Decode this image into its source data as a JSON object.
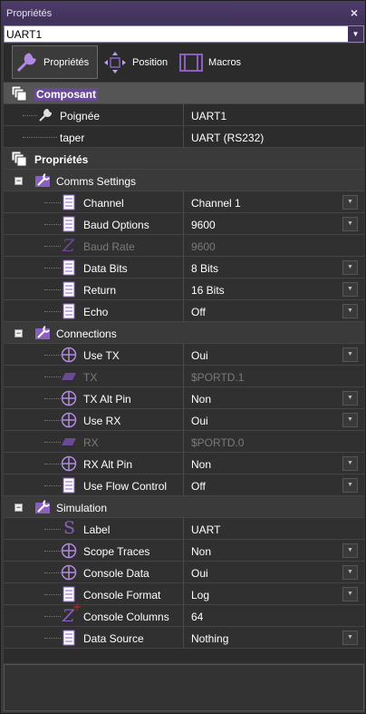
{
  "window": {
    "title": "Propriétés",
    "close_glyph": "×"
  },
  "selector": {
    "value": "UART1",
    "dropdown_glyph": "▼"
  },
  "toolbar": {
    "tabs": [
      {
        "label": "Propriétés",
        "icon": "wrench-icon"
      },
      {
        "label": "Position",
        "icon": "move-arrows-icon"
      },
      {
        "label": "Macros",
        "icon": "macro-icon"
      }
    ]
  },
  "sections": {
    "composant": {
      "label": "Composant",
      "rows": [
        {
          "name": "Poignée",
          "value": "UART1",
          "icon": "wrench-icon"
        },
        {
          "name": "taper",
          "value": "UART (RS232)",
          "icon": ""
        }
      ]
    },
    "proprietes": {
      "label": "Propriétés"
    }
  },
  "groups": {
    "comms": {
      "label": "Comms Settings",
      "rows": [
        {
          "name": "Channel",
          "value": "Channel 1",
          "icon": "list-icon",
          "enabled": true,
          "dropdown": true
        },
        {
          "name": "Baud Options",
          "value": "9600",
          "icon": "list-icon",
          "enabled": true,
          "dropdown": true
        },
        {
          "name": "Baud Rate",
          "value": "9600",
          "icon": "integer-icon",
          "enabled": false,
          "dropdown": false
        },
        {
          "name": "Data Bits",
          "value": "8 Bits",
          "icon": "list-icon",
          "enabled": true,
          "dropdown": true
        },
        {
          "name": "Return",
          "value": "16 Bits",
          "icon": "list-icon",
          "enabled": true,
          "dropdown": true
        },
        {
          "name": "Echo",
          "value": "Off",
          "icon": "list-icon",
          "enabled": true,
          "dropdown": true
        }
      ]
    },
    "connections": {
      "label": "Connections",
      "rows": [
        {
          "name": "Use TX",
          "value": "Oui",
          "icon": "boolean-icon",
          "enabled": true,
          "dropdown": true
        },
        {
          "name": "TX",
          "value": "$PORTD.1",
          "icon": "pin-icon",
          "enabled": false,
          "dropdown": false
        },
        {
          "name": "TX Alt Pin",
          "value": "Non",
          "icon": "boolean-icon",
          "enabled": true,
          "dropdown": true
        },
        {
          "name": "Use RX",
          "value": "Oui",
          "icon": "boolean-icon",
          "enabled": true,
          "dropdown": true
        },
        {
          "name": "RX",
          "value": "$PORTD.0",
          "icon": "pin-icon",
          "enabled": false,
          "dropdown": false
        },
        {
          "name": "RX Alt Pin",
          "value": "Non",
          "icon": "boolean-icon",
          "enabled": true,
          "dropdown": true
        },
        {
          "name": "Use Flow Control",
          "value": "Off",
          "icon": "list-icon",
          "enabled": true,
          "dropdown": true
        }
      ]
    },
    "simulation": {
      "label": "Simulation",
      "rows": [
        {
          "name": "Label",
          "value": "UART",
          "icon": "string-icon",
          "enabled": true,
          "dropdown": false
        },
        {
          "name": "Scope Traces",
          "value": "Non",
          "icon": "boolean-icon",
          "enabled": true,
          "dropdown": true
        },
        {
          "name": "Console Data",
          "value": "Oui",
          "icon": "boolean-icon",
          "enabled": true,
          "dropdown": true
        },
        {
          "name": "Console Format",
          "value": "Log",
          "icon": "list-icon",
          "enabled": true,
          "dropdown": true
        },
        {
          "name": "Console Columns",
          "value": "64",
          "icon": "integer-star-icon",
          "enabled": true,
          "dropdown": false
        },
        {
          "name": "Data Source",
          "value": "Nothing",
          "icon": "list-icon",
          "enabled": true,
          "dropdown": true
        }
      ]
    }
  },
  "colors": {
    "accent": "#8a5fc0",
    "header_bg": "#555555",
    "row_bg": "#303030",
    "disabled_text": "#7a7a7a"
  }
}
